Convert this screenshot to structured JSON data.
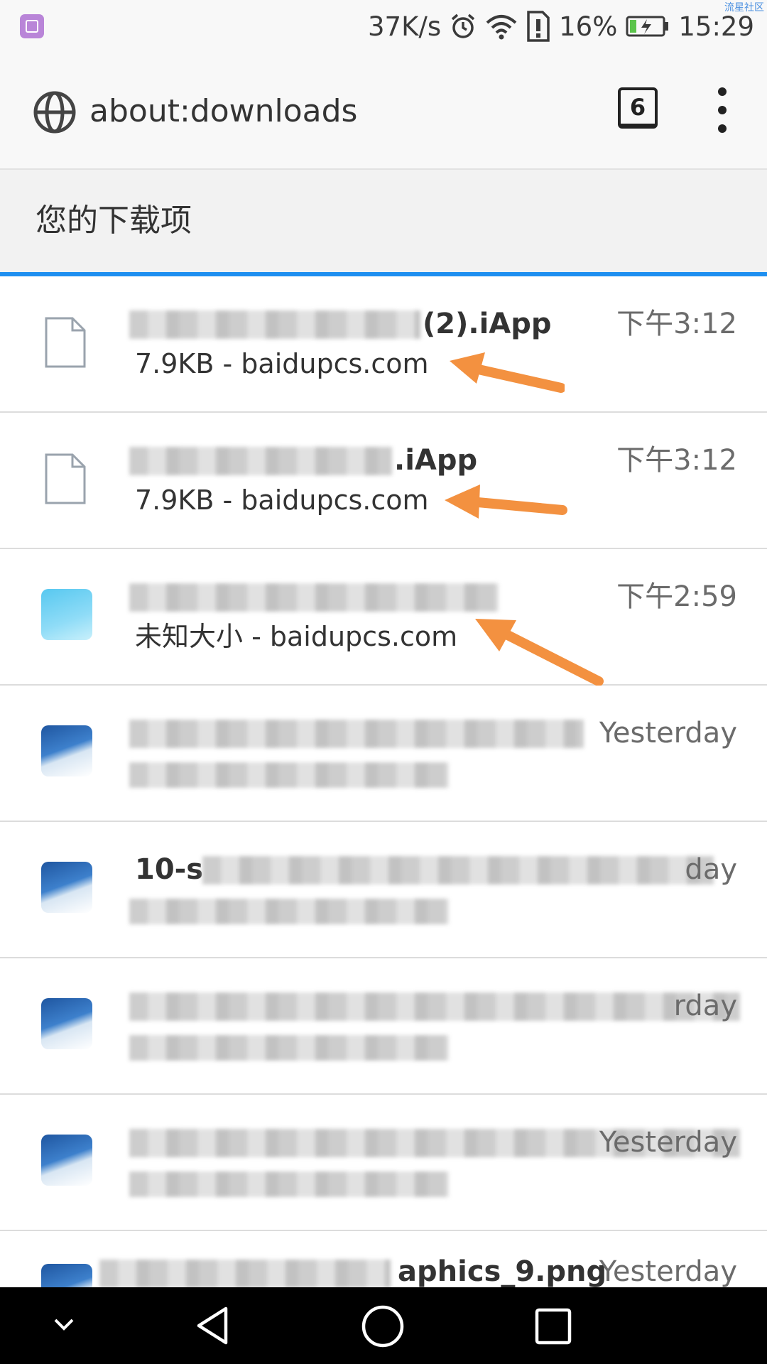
{
  "status_bar": {
    "net_speed": "37K/s",
    "battery_percent": "16%",
    "time": "15:29",
    "corner_tag": "流星社区",
    "icons": [
      "gallery-icon",
      "alarm-icon",
      "wifi-icon",
      "sim-alert-icon",
      "battery-charging-icon"
    ]
  },
  "toolbar": {
    "url": "about:downloads",
    "tab_count": "6",
    "icons": [
      "globe-icon",
      "tabs-icon",
      "overflow-menu-icon"
    ]
  },
  "section": {
    "title": "您的下载项"
  },
  "downloads": [
    {
      "name": "(2).iApp",
      "size": "7.9KB",
      "separator": " - ",
      "source": "baidupcs.com",
      "time": "下午3:12",
      "icon": "file-icon"
    },
    {
      "name": ".iApp",
      "size": "7.9KB",
      "separator": " - ",
      "source": "baidupcs.com",
      "time": "下午3:12",
      "icon": "file-icon"
    },
    {
      "name": "",
      "size": "未知大小",
      "separator": " - ",
      "source": "baidupcs.com",
      "time": "下午2:59",
      "icon": "app-icon"
    },
    {
      "name": "",
      "size": "",
      "separator": "",
      "source": "",
      "time": "Yesterday",
      "icon": "image-icon"
    },
    {
      "name": "10-s",
      "size": "",
      "separator": "",
      "source": "",
      "time": "day",
      "icon": "image-icon"
    },
    {
      "name": "",
      "size": "",
      "separator": "",
      "source": "",
      "time": "rday",
      "icon": "image-icon"
    },
    {
      "name": "",
      "size": "",
      "separator": "",
      "source": "",
      "time": "Yesterday",
      "icon": "image-icon"
    },
    {
      "name": "aphics_9.png",
      "size": "",
      "separator": "",
      "source": "",
      "time": "Yesterday",
      "icon": "image-icon"
    }
  ],
  "annotation_color": "#f39140",
  "accent_color": "#1e8ff0",
  "nav_bar": {
    "icons": [
      "collapse-icon",
      "back-icon",
      "home-icon",
      "recents-icon"
    ]
  }
}
